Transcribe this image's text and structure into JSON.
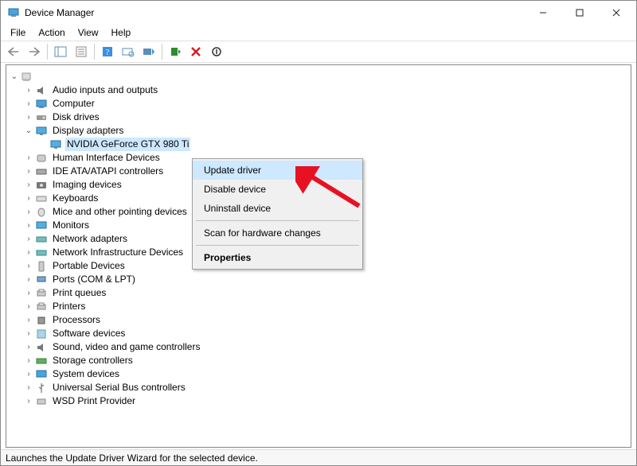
{
  "window": {
    "title": "Device Manager"
  },
  "menu": {
    "file": "File",
    "action": "Action",
    "view": "View",
    "help": "Help"
  },
  "tree": {
    "root_label": "",
    "selected_device": "NVIDIA GeForce GTX 980 Ti",
    "categories": [
      {
        "label": "Audio inputs and outputs"
      },
      {
        "label": "Computer"
      },
      {
        "label": "Disk drives"
      },
      {
        "label": "Display adapters",
        "expanded": true
      },
      {
        "label": "Human Interface Devices"
      },
      {
        "label": "IDE ATA/ATAPI controllers"
      },
      {
        "label": "Imaging devices"
      },
      {
        "label": "Keyboards"
      },
      {
        "label": "Mice and other pointing devices"
      },
      {
        "label": "Monitors"
      },
      {
        "label": "Network adapters"
      },
      {
        "label": "Network Infrastructure Devices"
      },
      {
        "label": "Portable Devices"
      },
      {
        "label": "Ports (COM & LPT)"
      },
      {
        "label": "Print queues"
      },
      {
        "label": "Printers"
      },
      {
        "label": "Processors"
      },
      {
        "label": "Software devices"
      },
      {
        "label": "Sound, video and game controllers"
      },
      {
        "label": "Storage controllers"
      },
      {
        "label": "System devices"
      },
      {
        "label": "Universal Serial Bus controllers"
      },
      {
        "label": "WSD Print Provider"
      }
    ]
  },
  "context_menu": {
    "update": "Update driver",
    "disable": "Disable device",
    "uninstall": "Uninstall device",
    "scan": "Scan for hardware changes",
    "properties": "Properties"
  },
  "statusbar": {
    "text": "Launches the Update Driver Wizard for the selected device."
  },
  "colors": {
    "highlight": "#cde8ff",
    "arrow": "#e81123"
  }
}
